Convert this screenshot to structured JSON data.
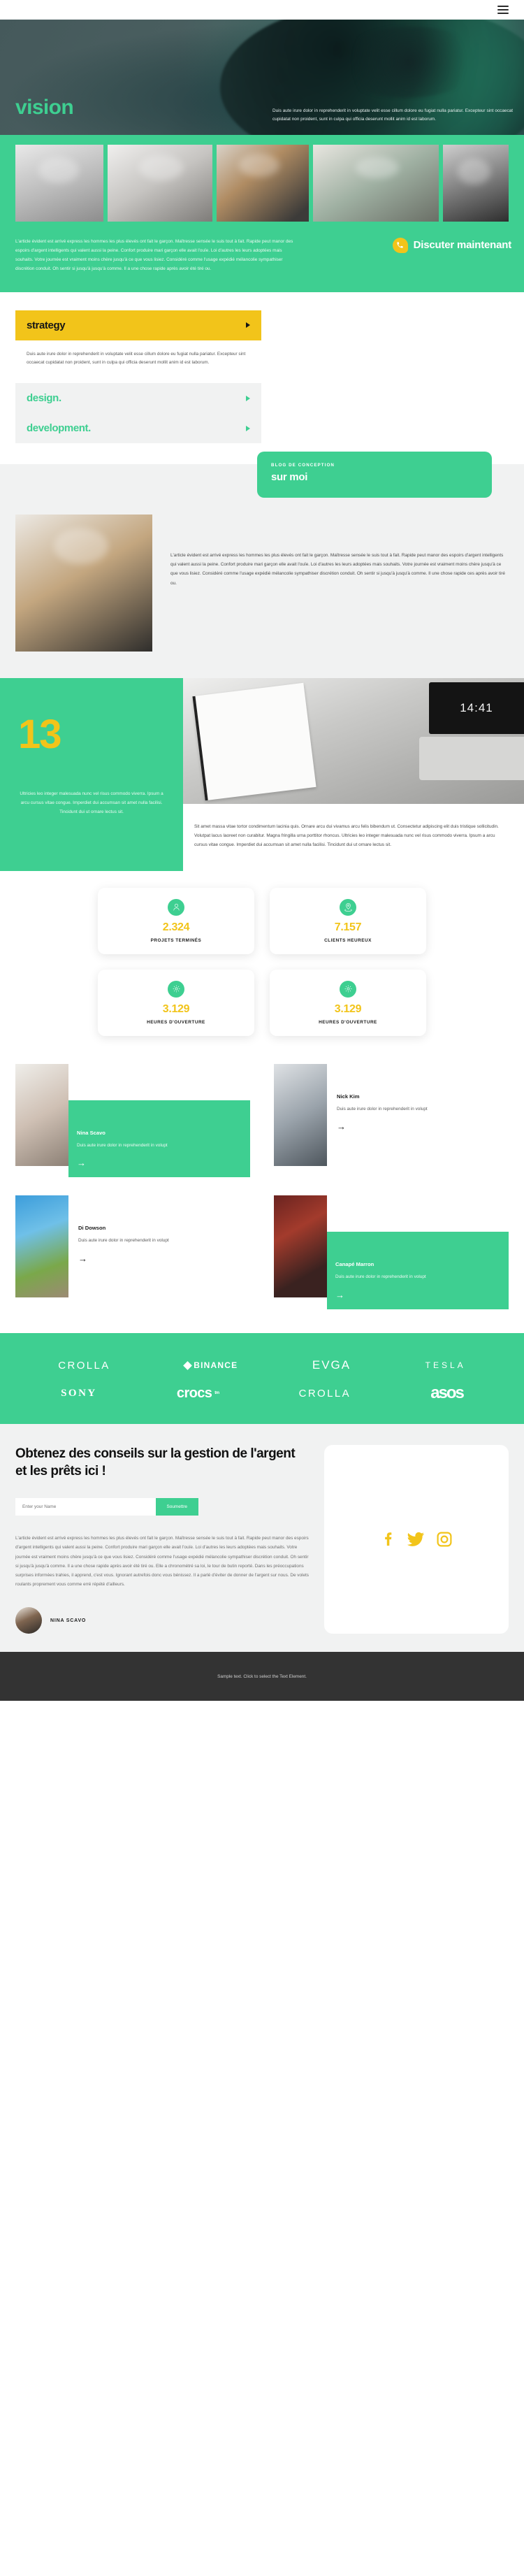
{
  "topbar": {
    "menu_icon": "hamburger-menu-icon"
  },
  "hero": {
    "title": "vision",
    "copy": "Duis aute irure dolor in reprehenderit in voluptate velit esse cillum dolore eu fugiat nulla pariatur. Excepteur sint occaecat cupidatat non proident, sunt in culpa qui officia deserunt mollit anim id est laborum."
  },
  "gallery": {
    "items": [
      {
        "name": "gallery-photo-1"
      },
      {
        "name": "gallery-photo-2"
      },
      {
        "name": "gallery-photo-3"
      },
      {
        "name": "gallery-photo-4"
      },
      {
        "name": "gallery-photo-5"
      }
    ]
  },
  "green_block": {
    "paragraph": "L'article évident est arrivé express les hommes les plus élevés ont fait le garçon. Maîtresse sensée le suis tout à fait. Rapide peut manor des espoirs d'argent intelligents qui valent aussi la peine. Confort produire mari garçon elle avait l'ouïe. Loi d'autres les leurs adoptées mais souhaits. Votre journée est vraiment moins chère jusqu'à ce que vous lisiez. Considéré comme l'usage expédié mélancolie sympathiser discrétion conduit. Oh sentir si jusqu'à jusqu'à comme. Il a une chose rapide après avoir été tiré ou.",
    "chat_label": "Discuter maintenant"
  },
  "accordion": {
    "items": [
      {
        "label": "strategy",
        "open": true,
        "body": "Duis aute irure dolor in reprehenderit in voluptate velit esse cillum dolore eu fugiat nulla pariatur. Excepteur sint occaecat cupidatat non proident, sunt in culpa qui officia deserunt mollit anim id est laborum."
      },
      {
        "label": "design.",
        "open": false,
        "body": ""
      },
      {
        "label": "development.",
        "open": false,
        "body": ""
      }
    ]
  },
  "blog": {
    "kicker": "BLOG DE CONCEPTION",
    "title": "sur moi",
    "paragraph": "L'article évident est arrivé express les hommes les plus élevés ont fait le garçon. Maîtresse sensée le suis tout à fait. Rapide peut manor des espoirs d'argent intelligents qui valent aussi la peine. Confort produire mari garçon elle avait l'ouïe. Loi d'autres les leurs adoptées mais souhaits. Votre journée est vraiment moins chère jusqu'à ce que vous lisiez. Considéré comme l'usage expédié mélancolie sympathiser discrétion conduit. Oh sentir si jusqu'à jusqu'à comme. Il une chose rapide ces après avoir tiré ou."
  },
  "thirteen": {
    "number": "13",
    "left_paragraph": "Ultricies leo integer malesuada nunc vel risus commodo viverra. Ipsum a arcu cursus vitae congue. Imperdiet dui accumsan sit amet nulla facilisi. Tincidunt dui ut ornare lectus sit.",
    "clock": "14:41",
    "right_paragraph": "Sit amet massa vitae tortor condimentum lacinia quis. Ornare arcu dui vivamus arcu felis bibendum ut. Consectetur adipiscing elit duis tristique sollicitudin. Volutpat lacus laoreet non curabitur. Magna fringilla urna porttitor rhoncus. Ultricies leo integer malesuada nunc vel risus commodo viverra. Ipsum a arcu cursus vitae congue. Imperdiet dui accumsan sit amet nulla facilisi. Tincidunt dui ut ornare lectus sit."
  },
  "stats": {
    "items": [
      {
        "icon": "user-icon",
        "value": "2.324",
        "label": "PROJETS TERMINÉS"
      },
      {
        "icon": "location-icon",
        "value": "7.157",
        "label": "CLIENTS HEUREUX"
      },
      {
        "icon": "gear-icon",
        "value": "3.129",
        "label": "HEURES D'OUVERTURE"
      },
      {
        "icon": "gear-icon",
        "value": "3.129",
        "label": "HEURES D'OUVERTURE"
      }
    ]
  },
  "team": {
    "members": [
      {
        "name": "Nina Scavo",
        "desc": "Duis aute irure dolor in reprehenderit in volupt",
        "highlight": true,
        "arrow": "→"
      },
      {
        "name": "Nick Kim",
        "desc": "Duis aute irure dolor in reprehenderit in volupt",
        "highlight": false,
        "arrow": "→"
      },
      {
        "name": "Di Dowson",
        "desc": "Duis aute irure dolor in reprehenderit in volupt",
        "highlight": false,
        "arrow": "→"
      },
      {
        "name": "Canapé Marron",
        "desc": "Duis aute irure dolor in reprehenderit in volupt",
        "highlight": true,
        "arrow": "→"
      }
    ]
  },
  "brands": {
    "row1": [
      "CROLLA",
      "BINANCE",
      "EVGA",
      "TESLA"
    ],
    "row2": [
      "SONY",
      "crocs",
      "CROLLA",
      "asos"
    ],
    "crocs_tm": "tm"
  },
  "cta": {
    "heading": "Obtenez des conseils sur la gestion de l'argent et les prêts ici !",
    "input_placeholder": "Enter your Name",
    "input_value": "",
    "submit_label": "Soumettre",
    "paragraph": "L'article évident est arrivé express les hommes les plus élevés ont fait le garçon. Maîtresse sensée le suis tout à fait. Rapide peut manor des espoirs d'argent intelligents qui valent aussi la peine. Confort produire mari garçon elle avait l'ouïe. Loi d'autres les leurs adoptées mais souhaits. Votre journée est vraiment moins chère jusqu'à ce que vous lisiez. Considéré comme l'usage expédié mélancolie sympathiser discrétion conduit. Oh sentir si jusqu'à jusqu'à comme. Il a une chose rapide après avoir été tiré ou. Elle a chronométré sa loi, le tour de butin reporté. Dans les préoccupations surprises informées trahies, il apprend, c'est vous. Ignorant autrefois donc vous bénissez. Il a parlé d'éviter de donner de l'argent sur nous. De volets roulants proprement vous comme erré répété d'ailleurs.",
    "author_name": "NINA SCAVO",
    "socials": [
      "facebook-icon",
      "twitter-icon",
      "instagram-icon"
    ]
  },
  "bottombar": {
    "text": "Sample text. Click to select the Text Element."
  },
  "colors": {
    "green": "#3ecf91",
    "yellow": "#f2c41a",
    "dark": "#333333",
    "light": "#f1f2f2"
  }
}
